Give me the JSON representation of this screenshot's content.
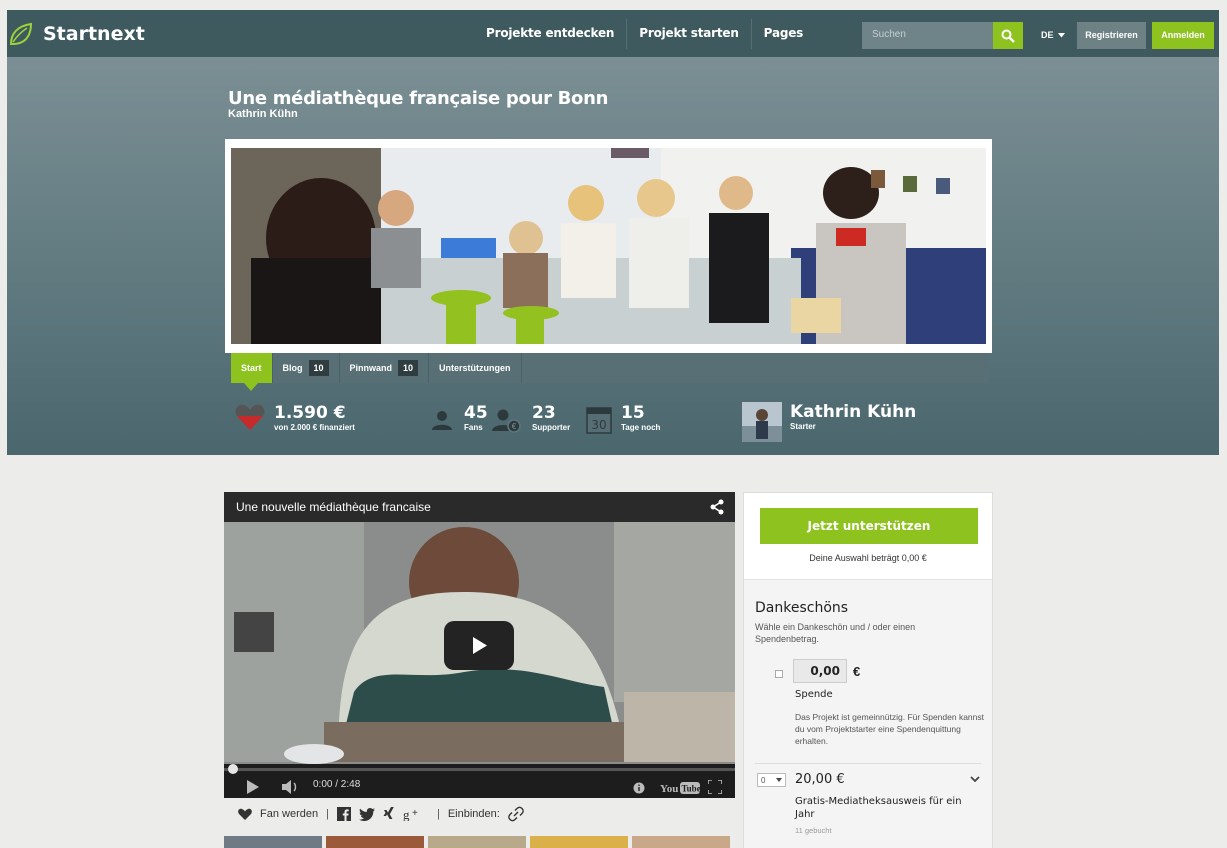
{
  "nav": {
    "logo_text": "Startnext",
    "links": [
      "Projekte entdecken",
      "Projekt starten",
      "Pages"
    ],
    "search_placeholder": "Suchen",
    "language": "DE",
    "register_label": "Registrieren",
    "login_label": "Anmelden"
  },
  "project": {
    "title": "Une médiathèque française pour Bonn",
    "author": "Kathrin Kühn"
  },
  "tabs": [
    {
      "label": "Start",
      "count": ""
    },
    {
      "label": "Blog",
      "count": "10"
    },
    {
      "label": "Pinnwand",
      "count": "10"
    },
    {
      "label": "Unterstützungen",
      "count": ""
    }
  ],
  "stats": {
    "funded_amount": "1.590 €",
    "funded_sub": "von 2.000 € finanziert",
    "fans_count": "45",
    "fans_label": "Fans",
    "supporter_count": "23",
    "supporter_label": "Supporter",
    "days_count": "15",
    "days_label": "Tage noch",
    "calendar_day": "30",
    "starter_name": "Kathrin Kühn",
    "starter_label": "Starter"
  },
  "video": {
    "title": "Une nouvelle médiathèque francaise",
    "time": "0:00 / 2:48",
    "progress": 0
  },
  "social": {
    "fan_label": "Fan werden",
    "embed_label": "Einbinden:"
  },
  "sidebar": {
    "support_button": "Jetzt unterstützen",
    "selection_text": "Deine Auswahl beträgt 0,00 €",
    "dankeschoens_title": "Dankeschöns",
    "dankeschoens_sub": "Wähle ein Dankeschön und / oder einen Spendenbetrag.",
    "donation_amount": "0,00",
    "currency": "€",
    "donation_label": "Spende",
    "donation_desc": "Das Projekt ist gemeinnützig. Für Spenden kannst du vom Projektstarter eine Spendenquittung erhalten.",
    "reward_qty": "0",
    "reward_amount": "20,00 €",
    "reward_title": "Gratis-Mediatheksausweis für ein Jahr",
    "reward_booked": "11 gebucht"
  },
  "colors": {
    "accent": "#8dc21f",
    "nav_bg": "#3f5a5f",
    "heart": "#c62a2a"
  }
}
